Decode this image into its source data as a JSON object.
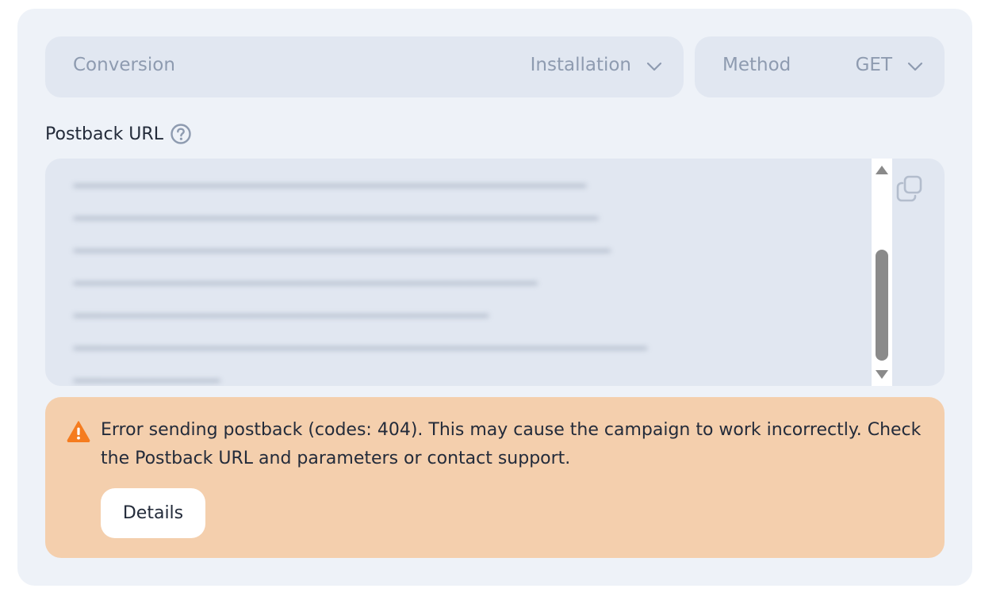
{
  "conversion": {
    "label": "Conversion",
    "value": "Installation"
  },
  "method": {
    "label": "Method",
    "value": "GET"
  },
  "postback": {
    "label": "Postback URL"
  },
  "alert": {
    "message": "Error sending postback (codes: 404). This may cause the campaign to work incorrectly. Check the Postback URL and parameters or contact support.",
    "details_label": "Details"
  },
  "colors": {
    "card_bg": "#eef2f8",
    "field_bg": "#e1e7f1",
    "alert_bg": "#f4cfad",
    "warning": "#f57c1f",
    "text": "#232b3a",
    "muted": "#8e9bb0"
  },
  "icons": [
    "chevron-down-icon",
    "help-icon",
    "copy-icon",
    "warning-icon"
  ]
}
